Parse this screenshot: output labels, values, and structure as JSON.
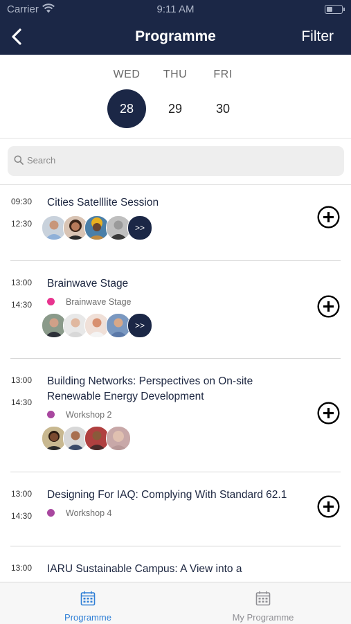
{
  "status_bar": {
    "carrier": "Carrier",
    "time": "9:11 AM"
  },
  "nav": {
    "title": "Programme",
    "filter_label": "Filter"
  },
  "days": [
    {
      "name": "WED",
      "number": "28",
      "selected": true
    },
    {
      "name": "THU",
      "number": "29",
      "selected": false
    },
    {
      "name": "FRI",
      "number": "30",
      "selected": false
    }
  ],
  "search": {
    "placeholder": "Search"
  },
  "sessions": [
    {
      "start": "09:30",
      "end": "12:30",
      "title": "Cities Satelllite Session",
      "location": "",
      "more_label": ">>"
    },
    {
      "start": "13:00",
      "end": "14:30",
      "title": "Brainwave Stage",
      "location": "Brainwave Stage",
      "location_color": "#e8348f",
      "more_label": ">>"
    },
    {
      "start": "13:00",
      "end": "14:30",
      "title": "Building Networks: Perspectives on On-site Renewable Energy Development",
      "location": "Workshop 2",
      "location_color": "#a8479f"
    },
    {
      "start": "13:00",
      "end": "14:30",
      "title": "Designing For IAQ: Complying With Standard 62.1",
      "location": "Workshop 4",
      "location_color": "#a8479f"
    },
    {
      "start": "13:00",
      "end": "",
      "title": "IARU Sustainable Campus: A View into a",
      "location": ""
    }
  ],
  "tabs": [
    {
      "label": "Programme",
      "active": true
    },
    {
      "label": "My Programme",
      "active": false
    }
  ],
  "colors": {
    "primary": "#1b2746",
    "tab_active": "#2f7fd6",
    "tab_inactive": "#8e8e93"
  }
}
